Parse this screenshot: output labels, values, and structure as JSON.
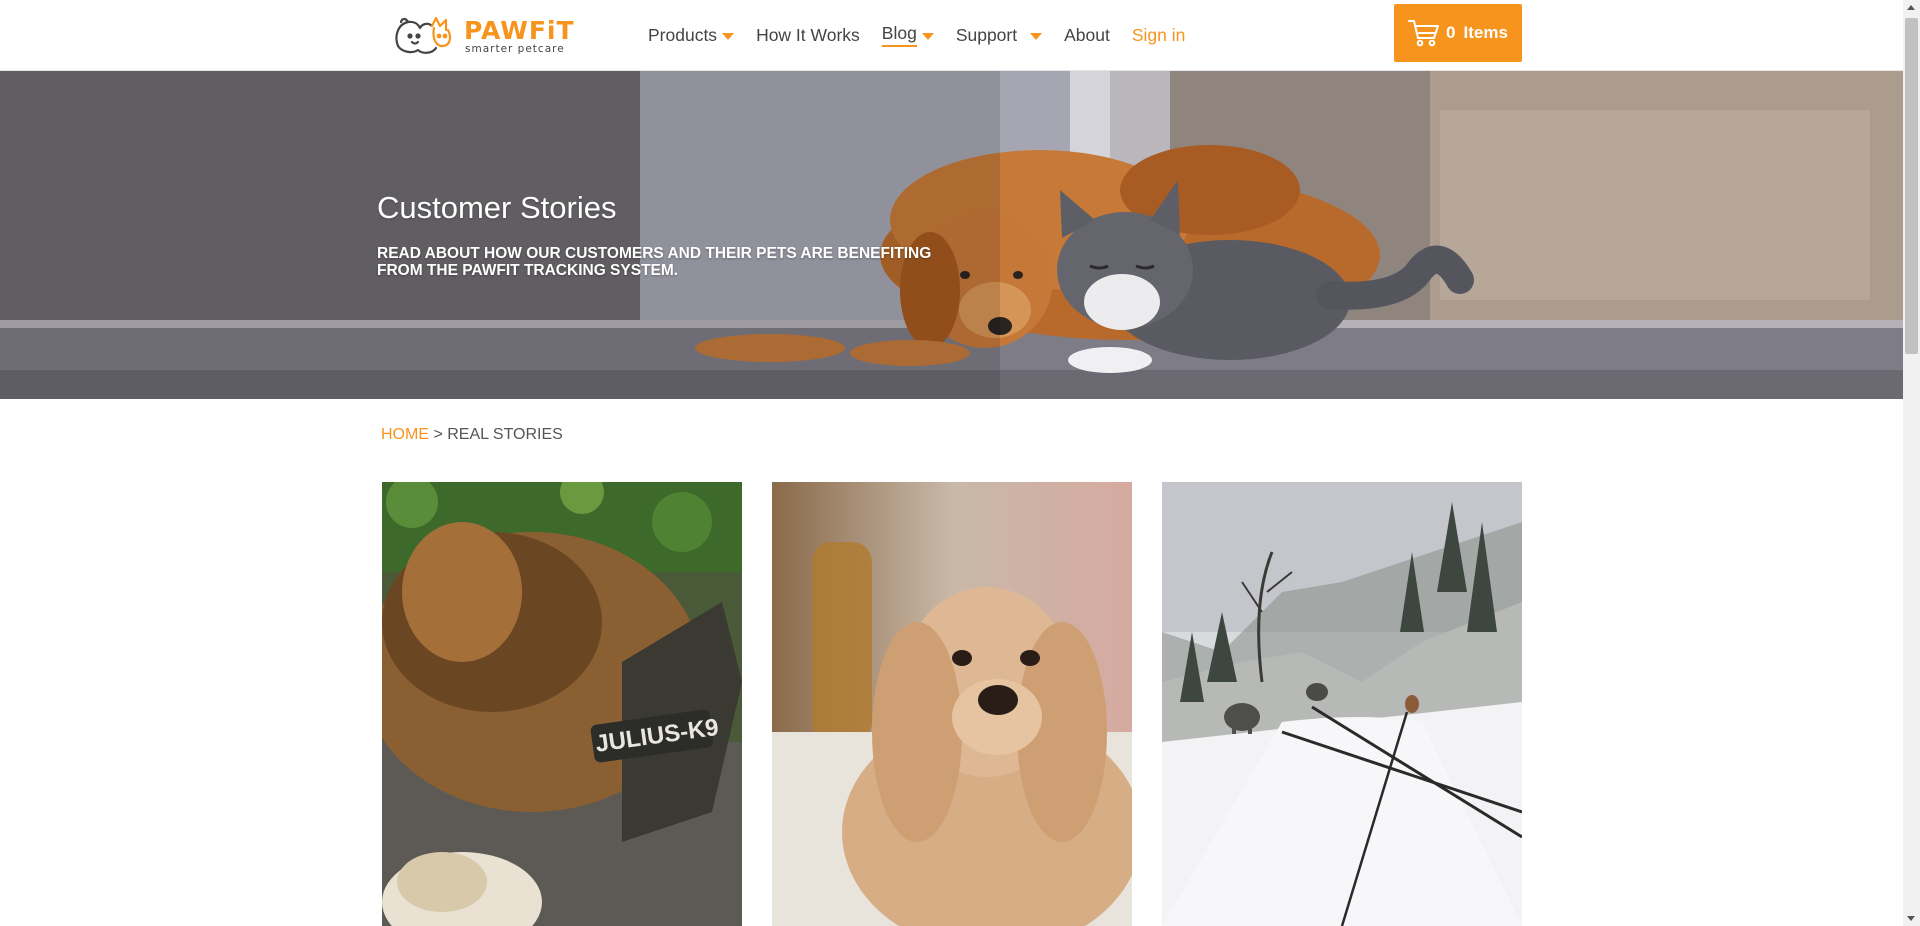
{
  "brand": {
    "name": "PAWFiT",
    "tagline": "smarter petcare"
  },
  "nav": {
    "items": [
      {
        "label": "Products",
        "has_dropdown": true
      },
      {
        "label": "How It Works",
        "has_dropdown": false
      },
      {
        "label": "Blog",
        "has_dropdown": true,
        "active": true
      },
      {
        "label": "Support",
        "has_dropdown": true
      },
      {
        "label": "About",
        "has_dropdown": false
      }
    ],
    "signin_label": "Sign in"
  },
  "cart": {
    "count": "0",
    "label": "Items",
    "icon": "shopping-cart-icon"
  },
  "hero": {
    "title": "Customer Stories",
    "subtitle": "READ ABOUT HOW OUR CUSTOMERS AND THEIR PETS ARE BENEFITING FROM THE PAWFIT TRACKING SYSTEM."
  },
  "breadcrumb": {
    "home": "HOME",
    "separator": ">",
    "current": "REAL STORIES"
  },
  "stories": [
    {
      "image": "german-shepherd-in-harness",
      "harness_text": "JULIUS-K9"
    },
    {
      "image": "cocker-spaniel-portrait"
    },
    {
      "image": "dogs-walking-snowy-trail"
    }
  ],
  "colors": {
    "accent": "#f7941d",
    "text": "#444444",
    "header_bg": "#ffffff"
  }
}
